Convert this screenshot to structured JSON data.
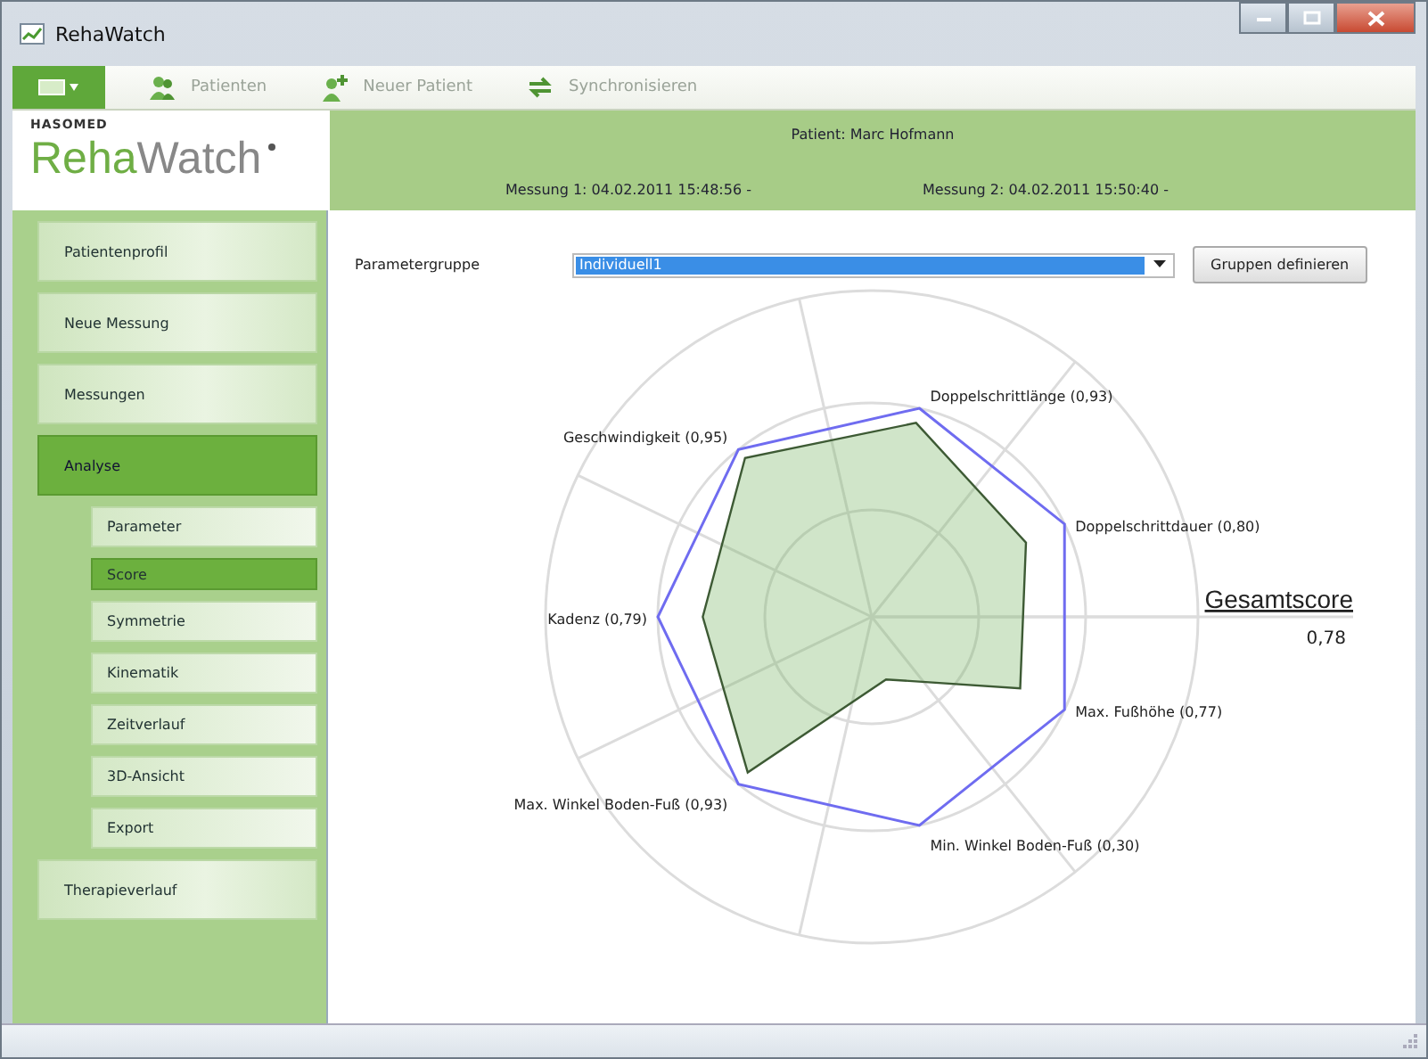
{
  "window": {
    "title": "RehaWatch"
  },
  "toolbar": [
    {
      "kind": "patients",
      "label": "Patienten"
    },
    {
      "kind": "add",
      "label": "Neuer Patient"
    },
    {
      "kind": "sync",
      "label": "Synchronisieren"
    }
  ],
  "logo": {
    "brand": "HASOMED",
    "parts": [
      "Reha",
      "Watch"
    ]
  },
  "header": {
    "patient": "Patient: Marc Hofmann",
    "measurement_1": "Messung 1: 04.02.2011 15:48:56 -",
    "measurement_2": "Messung 2: 04.02.2011 15:50:40 -"
  },
  "sidebar": {
    "items": [
      {
        "label": "Patientenprofil",
        "selected": false
      },
      {
        "label": "Neue Messung",
        "selected": false
      },
      {
        "label": "Messungen",
        "selected": false
      },
      {
        "label": "Analyse",
        "selected": true,
        "children": [
          {
            "label": "Parameter",
            "selected": false
          },
          {
            "label": "Score",
            "selected": true
          },
          {
            "label": "Symmetrie",
            "selected": false
          },
          {
            "label": "Kinematik",
            "selected": false
          },
          {
            "label": "Zeitverlauf",
            "selected": false
          },
          {
            "label": "3D-Ansicht",
            "selected": false
          },
          {
            "label": "Export",
            "selected": false
          }
        ]
      },
      {
        "label": "Therapieverlauf",
        "selected": false
      }
    ]
  },
  "parameter_group": {
    "label": "Parametergruppe",
    "value": "Individuell1",
    "button": "Gruppen definieren"
  },
  "score": {
    "title": "Gesamtscore",
    "value": "0,78",
    "axes": [
      {
        "label": "Doppelschrittlänge (0,93)"
      },
      {
        "label": "Geschwindigkeit (0,95)"
      },
      {
        "label": "Doppelschrittdauer (0,80)"
      },
      {
        "label": "Kadenz (0,79)"
      },
      {
        "label": "Max. Fußhöhe (0,77)"
      },
      {
        "label": "Max. Winkel Boden-Fuß (0,93)"
      },
      {
        "label": "Min. Winkel Boden-Fuß (0,30)"
      }
    ]
  }
}
